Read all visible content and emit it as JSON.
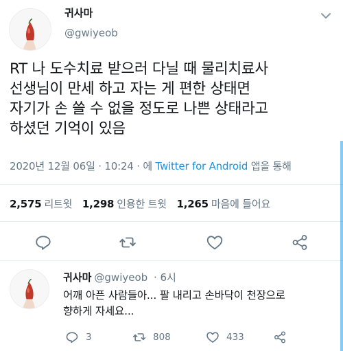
{
  "main_tweet": {
    "name": "귀사마",
    "handle": "@gwiyeob",
    "text_lines": [
      "RT 나 도수치료 받으러 다닐 때 물리치료사",
      "선생님이 만세 하고 자는 게 편한 상태면",
      "자기가 손 쓸 수 없을 정도로 나쁜 상태라고",
      "하셨던 기억이 있음"
    ],
    "date": "2020년 12월 06일",
    "time": "10:24",
    "via_prefix": "에",
    "source": "Twitter for Android",
    "via_suffix": "앱을 통해",
    "retweets": "2,575",
    "retweets_label": "리트윗",
    "quotes": "1,298",
    "quotes_label": "인용한 트윗",
    "likes": "1,265",
    "likes_label": "마음에 들어요"
  },
  "reply_tweet": {
    "name": "귀사마",
    "handle": "@gwiyeob",
    "age": "6시",
    "text_lines": [
      "어깨 아픈 사람들아... 팔 내리고 손바닥이 천장으로",
      "향하게 자세요..."
    ],
    "replies": "3",
    "retweets": "808",
    "likes": "433"
  },
  "icons": [
    "chevron-down-icon",
    "reply-icon",
    "retweet-icon",
    "like-icon",
    "share-icon"
  ],
  "colors": {
    "link": "#1b95e0",
    "muted": "#657786",
    "text": "#14171a",
    "avatar_bulb": "#c0392b"
  }
}
